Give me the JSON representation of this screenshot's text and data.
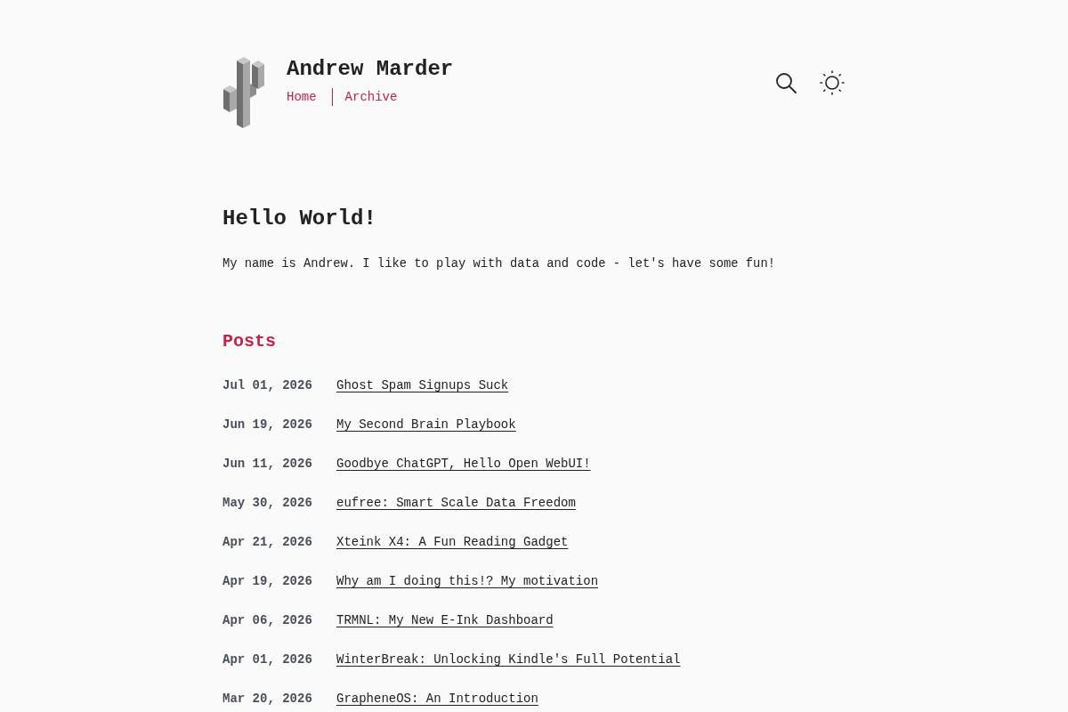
{
  "site": {
    "title": "Andrew Marder",
    "nav": [
      {
        "label": "Home"
      },
      {
        "label": "Archive"
      }
    ]
  },
  "intro": {
    "heading": "Hello World!",
    "text": "My name is Andrew. I like to play with data and code - let's have some fun!"
  },
  "posts": {
    "heading": "Posts",
    "items": [
      {
        "date": "Jul 01, 2026",
        "title": "Ghost Spam Signups Suck"
      },
      {
        "date": "Jun 19, 2026",
        "title": "My Second Brain Playbook"
      },
      {
        "date": "Jun 11, 2026",
        "title": "Goodbye ChatGPT, Hello Open WebUI!"
      },
      {
        "date": "May 30, 2026",
        "title": "eufree: Smart Scale Data Freedom"
      },
      {
        "date": "Apr 21, 2026",
        "title": "Xteink X4: A Fun Reading Gadget"
      },
      {
        "date": "Apr 19, 2026",
        "title": "Why am I doing this!? My motivation"
      },
      {
        "date": "Apr 06, 2026",
        "title": "TRMNL: My New E-Ink Dashboard"
      },
      {
        "date": "Apr 01, 2026",
        "title": "WinterBreak: Unlocking Kindle's Full Potential"
      },
      {
        "date": "Mar 20, 2026",
        "title": "GrapheneOS: An Introduction"
      }
    ]
  }
}
